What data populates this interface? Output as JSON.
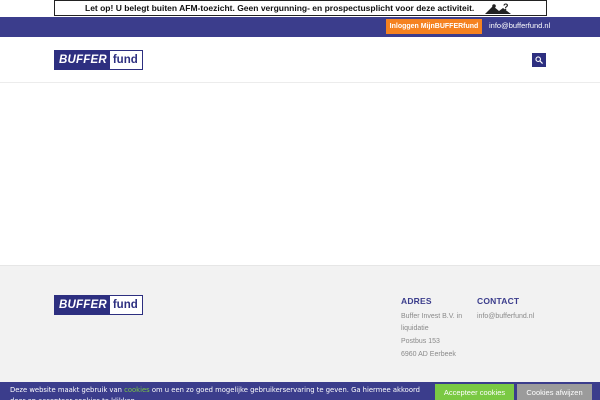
{
  "afm_banner": {
    "text": "Let op! U belegt buiten AFM-toezicht. Geen vergunning- en prospectusplicht voor deze activiteit.",
    "icon": "warning-person-icon"
  },
  "topbar": {
    "login_label": "Inloggen MijnBUFFERfund",
    "email": "info@bufferfund.nl"
  },
  "logo": {
    "part1": "BUFFER",
    "part2": "fund"
  },
  "header": {
    "search_icon": "search-icon"
  },
  "footer": {
    "address": {
      "title": "ADRES",
      "line1": "Buffer Invest B.V. in",
      "line2": "liquidatie",
      "line3": "Postbus 153",
      "line4": "6960 AD Eerbeek"
    },
    "contact": {
      "title": "CONTACT",
      "email": "info@bufferfund.nl"
    }
  },
  "cookie": {
    "text_before": "Deze website maakt gebruik van ",
    "link": "cookies",
    "text_after": " om u een zo goed mogelijke gebruikerservaring te geven. Ga hiermee akkoord door op accepteer cookies te klikken.",
    "accept_label": "Accepteer cookies",
    "decline_label": "Cookies afwijzen"
  },
  "colors": {
    "brand": "#3b3d8c",
    "accent": "#f58220",
    "accept": "#7ac943",
    "decline": "#9b9b9b"
  }
}
